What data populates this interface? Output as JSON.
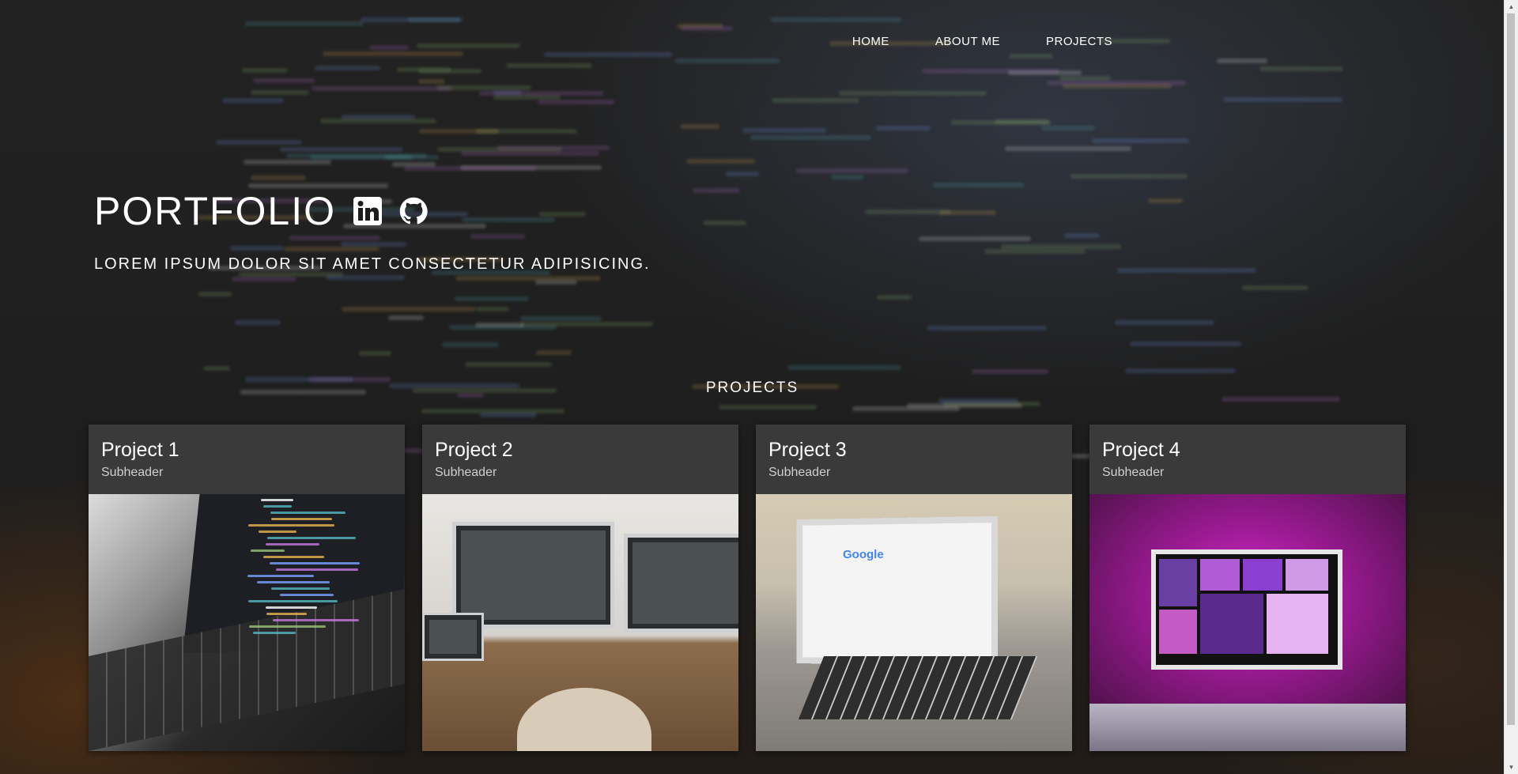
{
  "nav": {
    "home": "HOME",
    "about": "ABOUT ME",
    "projects": "PROJECTS"
  },
  "hero": {
    "title": "PORTFOLIO",
    "subtitle": "LOREM IPSUM DOLOR SIT AMET CONSECTETUR ADIPISICING.",
    "social_icons": [
      "linkedin-icon",
      "github-icon"
    ]
  },
  "projects": {
    "heading": "PROJECTS",
    "cards": [
      {
        "title": "Project 1",
        "subheader": "Subheader",
        "image": "laptop-code-photo"
      },
      {
        "title": "Project 2",
        "subheader": "Subheader",
        "image": "desk-monitors-photo"
      },
      {
        "title": "Project 3",
        "subheader": "Subheader",
        "image": "laptop-google-photo"
      },
      {
        "title": "Project 4",
        "subheader": "Subheader",
        "image": "pink-desk-photo"
      }
    ]
  },
  "image_text": {
    "google": "Google"
  },
  "colors": {
    "card_bg": "#3a3a3a",
    "page_bg": "#1c1c1c",
    "text": "#ffffff"
  }
}
